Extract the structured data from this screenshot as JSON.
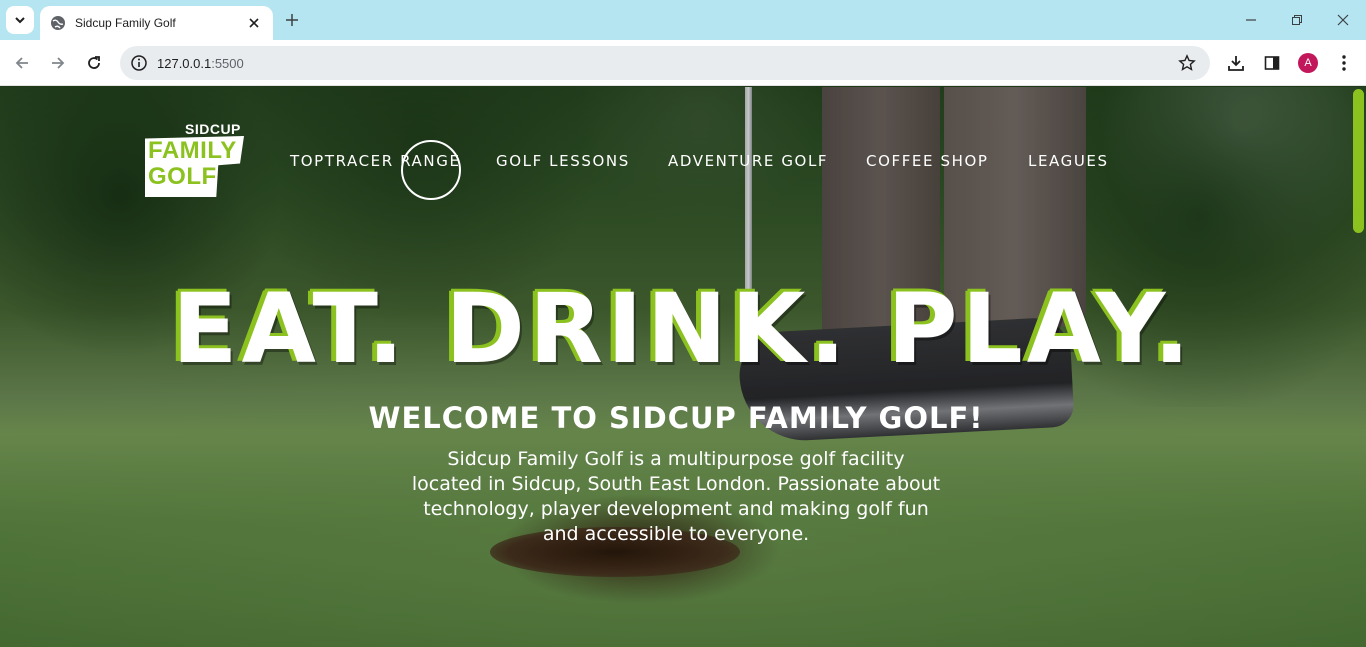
{
  "browser": {
    "tab_title": "Sidcup Family Golf",
    "url_host": "127.0.0.1",
    "url_port": ":5500",
    "profile_initial": "A"
  },
  "site": {
    "logo": {
      "top": "SIDCUP",
      "line1": "FAMILY",
      "line2": "GOLF"
    },
    "nav": [
      "TOPTRACER RANGE",
      "GOLF LESSONS",
      "ADVENTURE GOLF",
      "COFFEE SHOP",
      "LEAGUES"
    ],
    "headline": "EAT. DRINK. PLAY.",
    "welcome": "WELCOME TO SIDCUP FAMILY GOLF!",
    "intro": "Sidcup Family Golf is a multipurpose golf facility located in Sidcup, South East London. Passionate about technology, player development and making golf fun and accessible to everyone."
  },
  "colors": {
    "brand_green": "#8cc21f",
    "tab_strip": "#b6e5f2"
  },
  "icons": [
    "tab-search-icon",
    "globe-icon",
    "close-icon",
    "plus-icon",
    "minimize-icon",
    "restore-icon",
    "back-icon",
    "forward-icon",
    "reload-icon",
    "info-icon",
    "star-icon",
    "download-icon",
    "side-panel-icon",
    "menu-icon"
  ]
}
